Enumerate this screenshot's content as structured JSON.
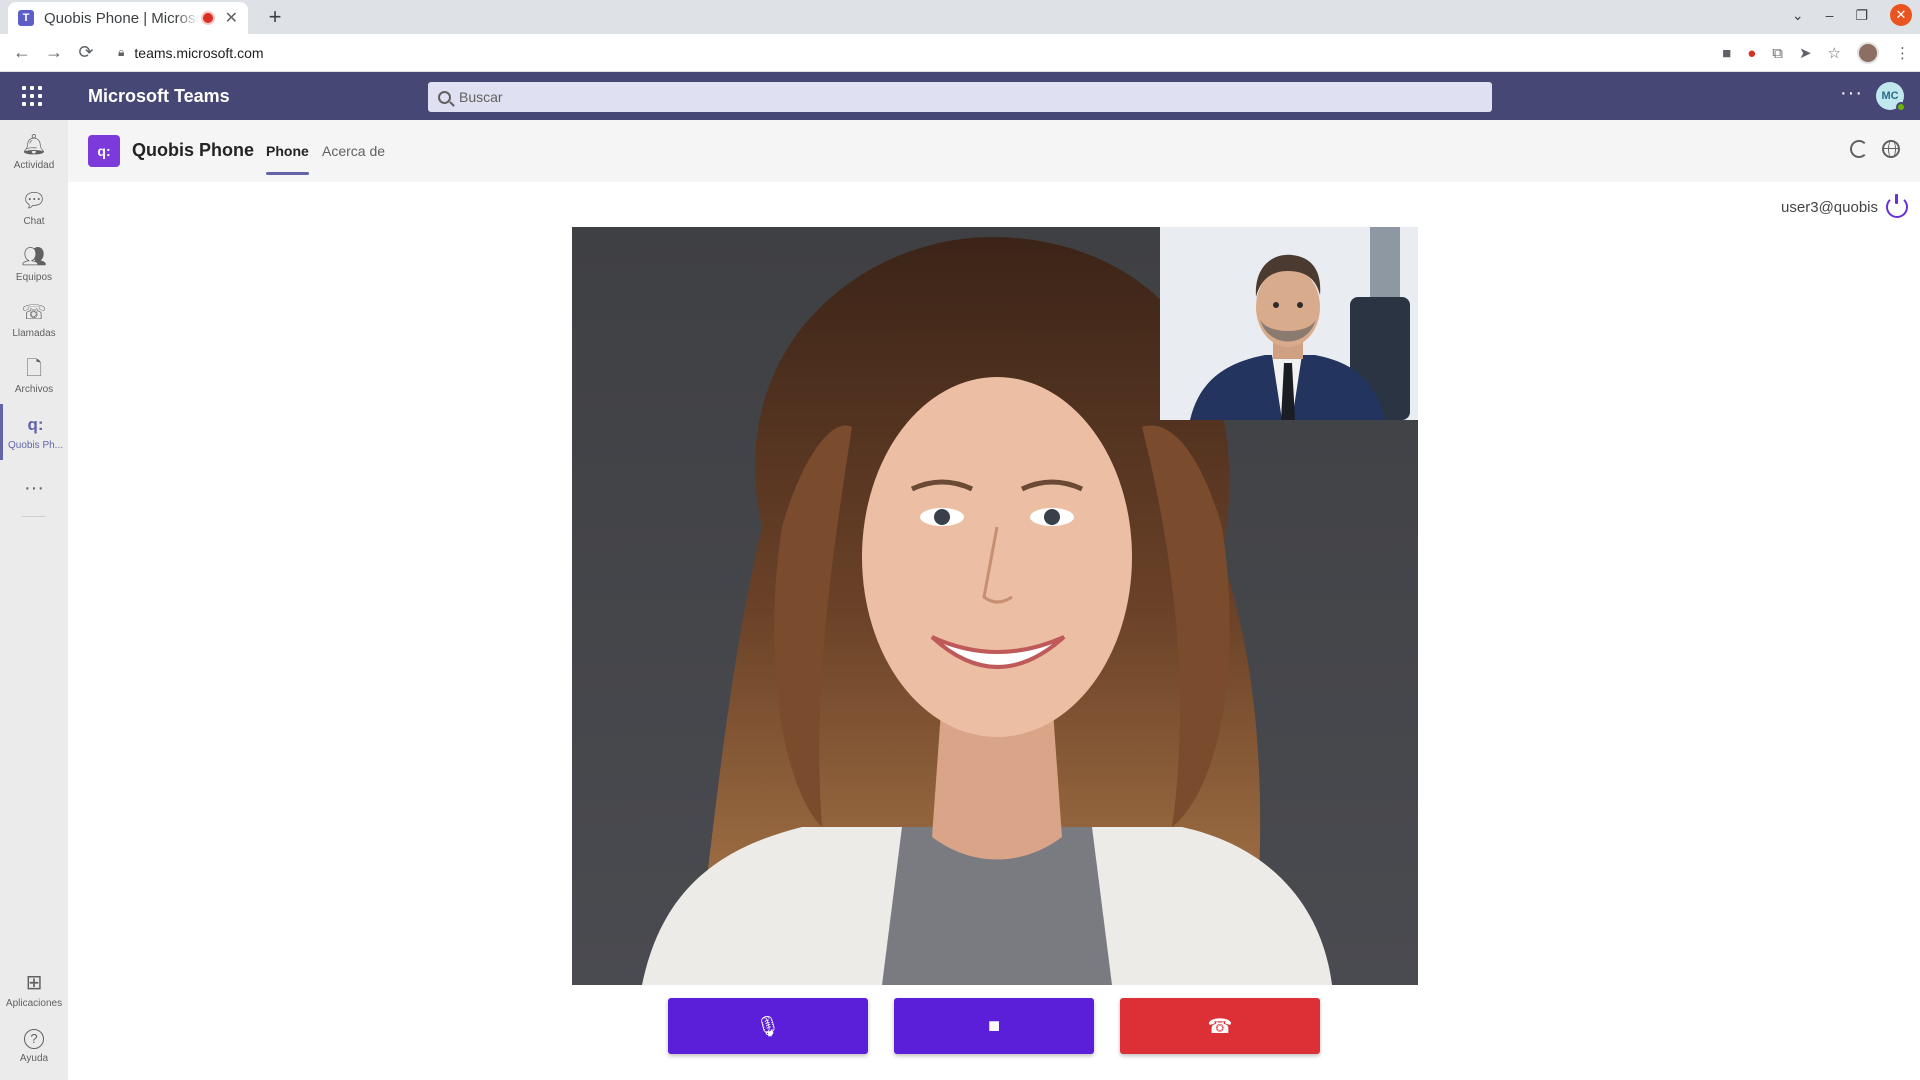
{
  "browser": {
    "tab_title": "Quobis Phone | Microsoft Teams",
    "new_tab": "+",
    "tab_close": "✕",
    "url": "teams.microsoft.com",
    "window_controls": {
      "dropdown": "⌄",
      "minimize": "–",
      "restore": "❐",
      "close": "✕"
    },
    "nav": {
      "back": "←",
      "forward": "→",
      "reload": "⟳"
    },
    "toolbar_icons": [
      "camera-icon",
      "recording-indicator-icon",
      "translate-icon",
      "send-icon",
      "star-icon",
      "profile-icon",
      "menu-icon"
    ]
  },
  "teams": {
    "app_name": "Microsoft Teams",
    "search_placeholder": "Buscar",
    "more": "···",
    "avatar_initials": "MC",
    "presence": "available"
  },
  "rail": {
    "items": [
      {
        "label": "Actividad",
        "icon": "bell-icon",
        "glyph": "🔔︎"
      },
      {
        "label": "Chat",
        "icon": "chat-icon",
        "glyph": "💬︎"
      },
      {
        "label": "Equipos",
        "icon": "teams-icon",
        "glyph": "👥︎"
      },
      {
        "label": "Llamadas",
        "icon": "phone-icon",
        "glyph": "☏"
      },
      {
        "label": "Archivos",
        "icon": "file-icon",
        "glyph": "🗋"
      },
      {
        "label": "Quobis Ph...",
        "icon": "quobis-icon",
        "glyph": "q:"
      }
    ],
    "more": "···",
    "bottom": [
      {
        "label": "Aplicaciones",
        "icon": "apps-icon",
        "glyph": "⊞"
      },
      {
        "label": "Ayuda",
        "icon": "help-icon",
        "glyph": "?"
      }
    ]
  },
  "app": {
    "logo": "q:",
    "title": "Quobis Phone",
    "tabs": [
      {
        "label": "Phone",
        "active": true
      },
      {
        "label": "Acerca de",
        "active": false
      }
    ]
  },
  "call": {
    "user": "user3@quobis",
    "buttons": [
      {
        "name": "mic",
        "icon": "microphone-icon",
        "glyph": "🎙︎",
        "color": "#5b1ed9"
      },
      {
        "name": "video",
        "icon": "video-camera-icon",
        "glyph": "■",
        "color": "#5b1ed9"
      },
      {
        "name": "hangup",
        "icon": "hang-up-icon",
        "glyph": "☎",
        "color": "#dc2f36"
      }
    ]
  },
  "colors": {
    "teams_header": "#464775",
    "accent": "#6264a7",
    "quobis_purple": "#5b1ed9",
    "hangup_red": "#dc2f36"
  }
}
